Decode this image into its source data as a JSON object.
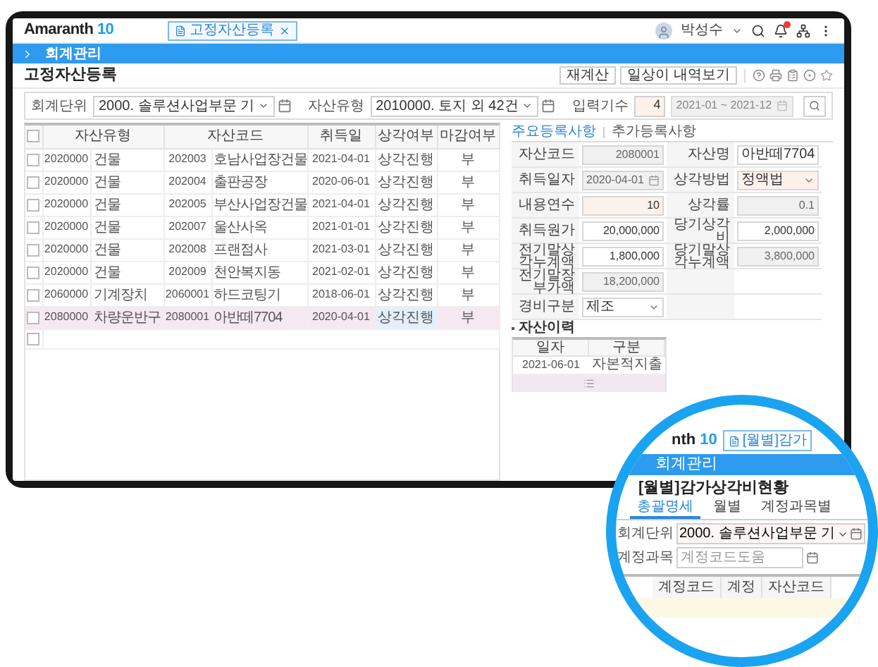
{
  "header": {
    "logo_word": "Amaranth",
    "logo_number": "10",
    "open_tab": {
      "label": "고정자산등록",
      "selected": true
    },
    "user": "박성수",
    "notification_badge": true
  },
  "module_bar": {
    "title": "회계관리"
  },
  "page": {
    "title": "고정자산등록",
    "buttons": [
      "재계산",
      "일상이 내역보기"
    ]
  },
  "filters": [
    {
      "kind": "select",
      "label": "회계단위",
      "value": "2000. 솔루션사업부문 기"
    },
    {
      "kind": "select",
      "label": "자산유형",
      "value": "2010000. 토지 외 42건"
    },
    {
      "kind": "period",
      "label": "입력기수",
      "value": "4",
      "range": "2021-01 ~ 2021-12"
    }
  ],
  "asset_table": {
    "select_all": {
      "checked": false
    },
    "blank_row": {
      "checked": false
    },
    "columns": [
      "자산유형",
      "자산코드",
      "취득일",
      "상각여부",
      "마감여부"
    ],
    "rows": [
      {
        "type_code": "2020000",
        "type_name": "건물",
        "asset_code": "202003",
        "asset_name": "호남사업장건물",
        "acquired": "2021-04-01",
        "depreciation": "상각진행",
        "closed": "부",
        "checked": false,
        "selected": false
      },
      {
        "type_code": "2020000",
        "type_name": "건물",
        "asset_code": "202004",
        "asset_name": "출판공장",
        "acquired": "2020-06-01",
        "depreciation": "상각진행",
        "closed": "부",
        "checked": false,
        "selected": false
      },
      {
        "type_code": "2020000",
        "type_name": "건물",
        "asset_code": "202005",
        "asset_name": "부산사업장건물",
        "acquired": "2021-04-01",
        "depreciation": "상각진행",
        "closed": "부",
        "checked": false,
        "selected": false
      },
      {
        "type_code": "2020000",
        "type_name": "건물",
        "asset_code": "202007",
        "asset_name": "울산사옥",
        "acquired": "2021-01-01",
        "depreciation": "상각진행",
        "closed": "부",
        "checked": false,
        "selected": false
      },
      {
        "type_code": "2020000",
        "type_name": "건물",
        "asset_code": "202008",
        "asset_name": "프랜점사",
        "acquired": "2021-03-01",
        "depreciation": "상각진행",
        "closed": "부",
        "checked": false,
        "selected": false
      },
      {
        "type_code": "2020000",
        "type_name": "건물",
        "asset_code": "202009",
        "asset_name": "천안복지동",
        "acquired": "2021-02-01",
        "depreciation": "상각진행",
        "closed": "부",
        "checked": false,
        "selected": false
      },
      {
        "type_code": "2060000",
        "type_name": "기계장치",
        "asset_code": "2060001",
        "asset_name": "하드코팅기",
        "acquired": "2018-06-01",
        "depreciation": "상각진행",
        "closed": "부",
        "checked": false,
        "selected": false
      },
      {
        "type_code": "2080000",
        "type_name": "차량운반구",
        "asset_code": "2080001",
        "asset_name": "아반떼7704",
        "acquired": "2020-04-01",
        "depreciation": "상각진행",
        "closed": "부",
        "checked": false,
        "selected": true
      }
    ]
  },
  "detail_tabs": [
    {
      "label": "주요등록사항",
      "selected": true
    },
    {
      "label": "추가등록사항",
      "selected": false
    }
  ],
  "detail_rows": [
    {
      "left": {
        "kind": "text",
        "label": "자산코드",
        "value": "2080001",
        "disabled": true,
        "required": false
      },
      "right": {
        "kind": "text",
        "label": "자산명",
        "value": "아반떼7704",
        "disabled": false,
        "required": false
      }
    },
    {
      "left": {
        "kind": "date",
        "label": "취득일자",
        "value": "2020-04-01",
        "disabled": true,
        "required": false
      },
      "right": {
        "kind": "select",
        "label": "상각방법",
        "value": "정액법",
        "disabled": false,
        "required": true
      }
    },
    {
      "left": {
        "kind": "text",
        "label": "내용연수",
        "value": "10",
        "disabled": false,
        "required": true
      },
      "right": {
        "kind": "text",
        "label": "상각률",
        "value": "0.1",
        "disabled": true,
        "required": false
      }
    },
    {
      "left": {
        "kind": "text",
        "label": "취득원가",
        "value": "20,000,000",
        "disabled": false,
        "required": false
      },
      "right": {
        "kind": "text",
        "label": "당기상각비",
        "value": "2,000,000",
        "disabled": false,
        "required": false
      }
    },
    {
      "left": {
        "kind": "text",
        "label": "전기말상각누계액",
        "value": "1,800,000",
        "disabled": false,
        "required": false
      },
      "right": {
        "kind": "text",
        "label": "당기말상각누계액",
        "value": "3,800,000",
        "disabled": true,
        "required": false
      }
    },
    {
      "left": {
        "kind": "text",
        "label": "전기말장부가액",
        "value": "18,200,000",
        "disabled": true,
        "required": false
      }
    },
    {
      "left": {
        "kind": "select",
        "label": "경비구분",
        "value": "제조",
        "disabled": false,
        "required": false
      }
    }
  ],
  "history": {
    "title": "자산이력",
    "columns": [
      "일자",
      "구분"
    ],
    "rows": [
      {
        "date": "2021-06-01",
        "type": "자본적지출"
      }
    ]
  },
  "zoom_view": {
    "logo_fragment": "nth",
    "logo_number": "10",
    "open_tab": "[월별]감가",
    "module": "회계관리",
    "title": "[월별]감가상각비현황",
    "tabs": [
      {
        "label": "총괄명세",
        "selected": true
      },
      {
        "label": "월별",
        "selected": false
      },
      {
        "label": "계정과목별",
        "selected": false
      }
    ],
    "filters": [
      {
        "kind": "select",
        "label": "회계단위",
        "value": "2000. 솔루션사업부문 기"
      },
      {
        "kind": "lookup",
        "label": "계정과목",
        "placeholder": "계정코드도움"
      }
    ],
    "columns": [
      "계정코드",
      "계정",
      "자산코드"
    ]
  }
}
